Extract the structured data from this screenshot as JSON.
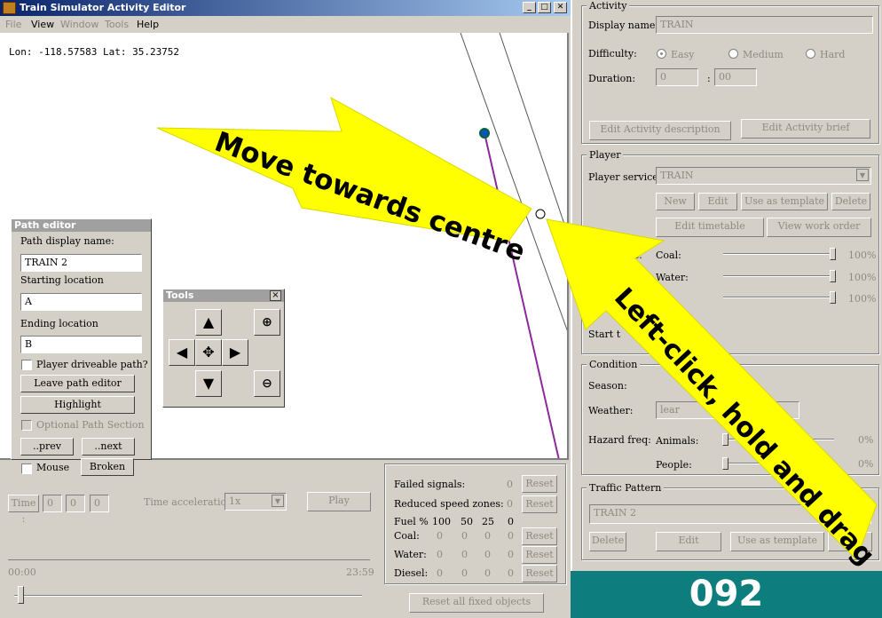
{
  "window": {
    "title": "Train Simulator Activity Editor"
  },
  "menu": [
    "File",
    "View",
    "Window",
    "Tools",
    "Help"
  ],
  "map": {
    "coords": "Lon: -118.57583 Lat: 35.23752"
  },
  "path_editor": {
    "title": "Path editor",
    "display_name_label": "Path display name:",
    "display_name_value": "TRAIN 2",
    "start_label": "Starting location",
    "start_value": "A",
    "end_label": "Ending location",
    "end_value": "B",
    "driveable_label": "Player driveable path?",
    "leave_label": "Leave path editor",
    "highlight_label": "Highlight",
    "optional_label": "Optional Path Section",
    "prev_label": "..prev",
    "next_label": "..next",
    "mouse_label": "Mouse",
    "broken_label": "Broken"
  },
  "tools": {
    "title": "Tools",
    "close": "×"
  },
  "timebar": {
    "time_label": "Time :",
    "time_values": [
      "0",
      "0",
      "0"
    ],
    "accel_label": "Time acceleration",
    "accel_value": "1x",
    "play_label": "Play",
    "start_time": "00:00",
    "end_time": "23:59",
    "time_position": 0.02
  },
  "failures": {
    "failed_signals_label": "Failed signals:",
    "failed_signals_value": "0",
    "reduced_speed_label": "Reduced speed zones:",
    "reduced_speed_value": "0",
    "reset_label": "Reset",
    "fuel_header": [
      "Fuel %",
      "100",
      "50",
      "25",
      "0"
    ],
    "rows": [
      {
        "label": "Coal:",
        "values": [
          "0",
          "0",
          "0",
          "0"
        ]
      },
      {
        "label": "Water:",
        "values": [
          "0",
          "0",
          "0",
          "0"
        ]
      },
      {
        "label": "Diesel:",
        "values": [
          "0",
          "0",
          "0",
          "0"
        ]
      }
    ],
    "reset_all_label": "Reset all fixed objects"
  },
  "activity": {
    "group_label": "Activity",
    "display_name_label": "Display name:",
    "display_name_value": "TRAIN",
    "difficulty_label": "Difficulty:",
    "difficulty_options": [
      "Easy",
      "Medium",
      "Hard"
    ],
    "difficulty_selected": "Easy",
    "duration_label": "Duration:",
    "duration_hours": "0",
    "duration_sep": ":",
    "duration_minutes": "00",
    "edit_description_label": "Edit Activity description",
    "edit_brief_label": "Edit Activity brief"
  },
  "player": {
    "group_label": "Player",
    "service_label": "Player service:",
    "service_value": "TRAIN",
    "new_label": "New",
    "edit_label": "Edit",
    "template_label": "Use as template",
    "delete_label": "Delete",
    "timetable_label": "Edit timetable",
    "work_order_label": "View work order",
    "status_label_partial": "tus:",
    "coal_label": "Coal:",
    "coal_value": "100%",
    "water_label": "Water:",
    "water_value": "100%",
    "third_value": "100%",
    "start_label_partial": "Start t"
  },
  "conditions": {
    "group_label": "Condition",
    "season_label": "Season:",
    "weather_label": "Weather:",
    "weather_value_partial": "lear",
    "hazard_label": "Hazard freq:",
    "animals_label": "Animals:",
    "animals_value": "0%",
    "people_label": "People:",
    "people_value": "0%"
  },
  "traffic": {
    "group_label": "Traffic Pattern",
    "value": "TRAIN 2",
    "delete_label": "Delete",
    "edit_label": "Edit",
    "template_label": "Use as template"
  },
  "overlay": {
    "arrow1_text": "Move towards centre",
    "arrow2_text": "Left-click, hold and drag",
    "frame_number": "092"
  }
}
